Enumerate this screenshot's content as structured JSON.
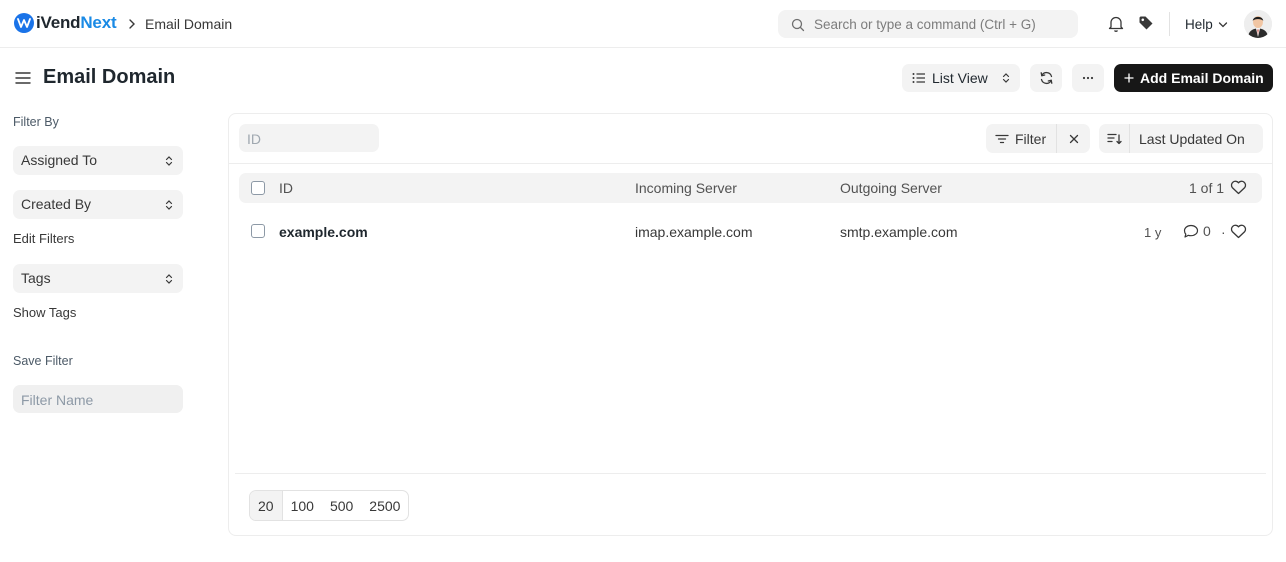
{
  "navbar": {
    "brand_part1": "iVend",
    "brand_part2": "Next",
    "breadcrumb": "Email Domain",
    "search_placeholder": "Search or type a command (Ctrl + G)",
    "help_label": "Help",
    "icons": [
      "brand-logo-icon",
      "chevron-right-icon",
      "search-icon",
      "bell-icon",
      "tag-icon",
      "chevron-down-icon",
      "avatar"
    ]
  },
  "page": {
    "title": "Email Domain",
    "view_label": "List View",
    "more_label": "···",
    "primary_action": "Add Email Domain",
    "primary_action_icon": "+"
  },
  "sidebar": {
    "filter_by": "Filter By",
    "assigned_to": "Assigned To",
    "created_by": "Created By",
    "edit_filters": "Edit Filters",
    "tags": "Tags",
    "show_tags": "Show Tags",
    "save_filter": "Save Filter",
    "filter_name_placeholder": "Filter Name"
  },
  "list": {
    "id_filter_placeholder": "ID",
    "filter_label": "Filter",
    "sort_label": "Last Updated On",
    "columns": [
      "ID",
      "Incoming Server",
      "Outgoing Server"
    ],
    "count": "1 of 1",
    "rows": [
      {
        "id": "example.com",
        "incoming_server": "imap.example.com",
        "outgoing_server": "smtp.example.com",
        "modified": "1 y",
        "comments": "0",
        "separator": "·"
      }
    ],
    "page_sizes": [
      "20",
      "100",
      "500",
      "2500"
    ],
    "active_page_size": "20"
  },
  "colors": {
    "brand_blue": "#1a8ae5",
    "primary_button": "#171717",
    "control_bg": "#f3f3f3"
  }
}
